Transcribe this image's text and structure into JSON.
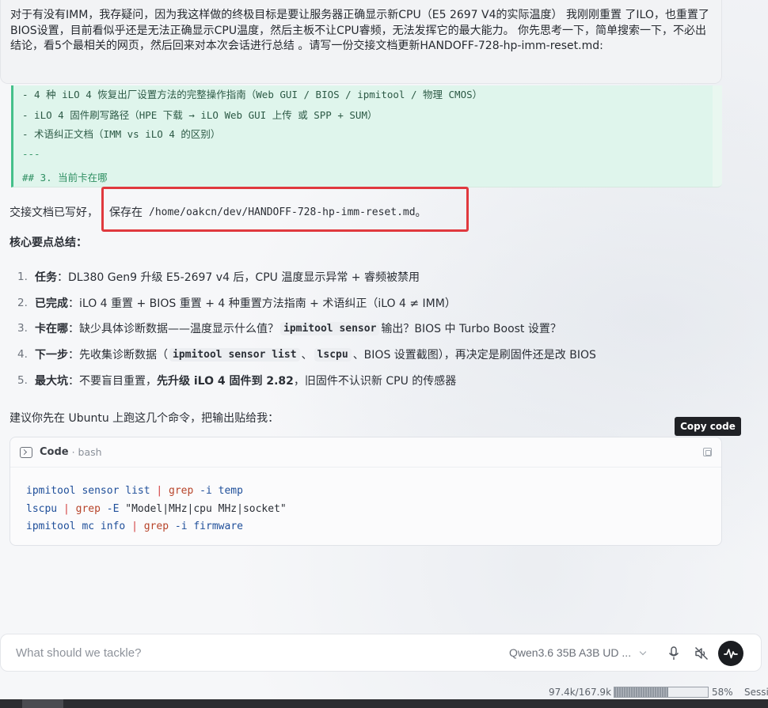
{
  "user_message": {
    "text": "对于有没有IMM，我存疑问，因为我这样做的终极目标是要让服务器正确显示新CPU（E5 2697 V4的实际温度） 我刚刚重置 了ILO，也重置了BIOS设置，目前看似乎还是无法正确显示CPU温度，然后主板不让CPU睿频，无法发挥它的最大能力。 你先思考一下，简单搜索一下，不必出结论，看5个最相关的网页，然后回来对本次会话进行总结 。请写一份交接文档更新HANDOFF-728-hp-imm-reset.md:"
  },
  "green_block": {
    "line_cut": "- 4 种 iLO 4 恢复出厂设置方法的完整操作指南（Web GUI / BIOS / ipmitool / 物理 CMOS）",
    "line1": "- iLO 4 固件刷写路径（HPE 下载 → iLO Web GUI 上传 或 SPP + SUM）",
    "line2": "- 术语纠正文档（IMM vs iLO 4 的区别）",
    "line3": "---",
    "line4": "## 3. 当前卡在哪"
  },
  "saved": {
    "prefix": "交接文档已写好，",
    "boxed_text": "保存在",
    "path": "/home/oakcn/dev/HANDOFF-728-hp-imm-reset.md",
    "suffix": "。"
  },
  "summary": {
    "heading": "核心要点总结：",
    "items": [
      {
        "num": "1.",
        "label": "任务",
        "text": "：DL380 Gen9 升级 E5-2697 v4 后，CPU 温度显示异常 + 睿频被禁用"
      },
      {
        "num": "2.",
        "label": "已完成",
        "text": "：iLO 4 重置 + BIOS 重置 + 4 种重置方法指南 + 术语纠正（iLO 4 ≠ IMM）"
      },
      {
        "num": "3.",
        "label": "卡在哪",
        "pre": "：缺少具体诊断数据——温度显示什么值？",
        "code": "ipmitool sensor",
        "post": " 输出？BIOS 中 Turbo Boost 设置？"
      },
      {
        "num": "4.",
        "label": "下一步",
        "pre": "：先收集诊断数据（",
        "code": "ipmitool sensor list",
        "mid": "、",
        "code2": "lscpu",
        "post": "、BIOS 设置截图），再决定是刷固件还是改 BIOS"
      },
      {
        "num": "5.",
        "label": "最大坑",
        "pre": "：不要盲目重置，",
        "bold": "先升级 iLO 4 固件到 2.82",
        "post": "，旧固件不认识新 CPU 的传感器"
      }
    ]
  },
  "suggest": "建议你先在 Ubuntu 上跑这几个命令，把输出贴给我：",
  "tooltip": "Copy code",
  "code_card": {
    "label": "Code",
    "lang": "· bash",
    "lines": [
      [
        "ipmitool",
        "sensor list",
        "|",
        "grep",
        "-i",
        "temp"
      ],
      [
        "lscpu",
        "",
        "|",
        "grep",
        "-E",
        "\"Model|MHz|cpu MHz|socket\""
      ],
      [
        "ipmitool",
        "mc info",
        "|",
        "grep",
        "-i",
        "firmware"
      ]
    ]
  },
  "composer": {
    "placeholder": "What should we tackle?",
    "model": "Qwen3.6 35B A3B UD ..."
  },
  "status": {
    "tokens": "97.4k/167.9k",
    "bar_left": "[",
    "progress": 0.58,
    "percent": "58%",
    "session": "Sessi"
  }
}
